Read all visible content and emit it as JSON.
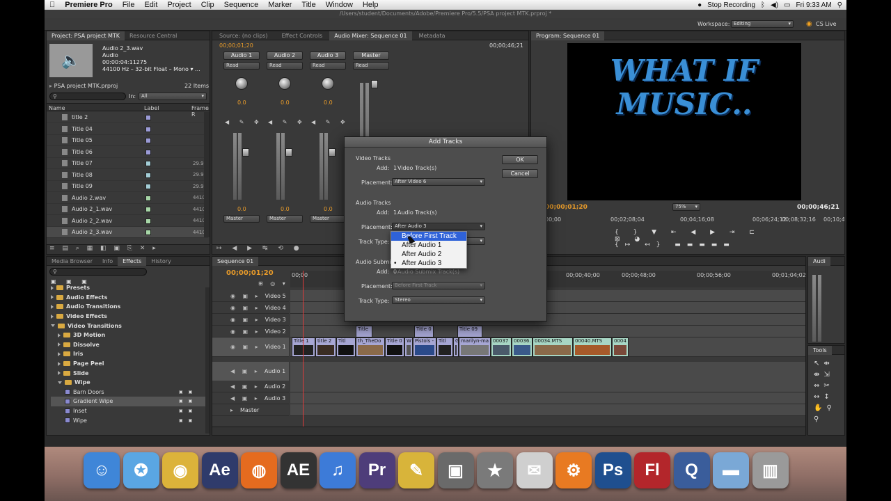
{
  "menubar": {
    "apple": "",
    "app": "Premiere Pro",
    "items": [
      "File",
      "Edit",
      "Project",
      "Clip",
      "Sequence",
      "Marker",
      "Title",
      "Window",
      "Help"
    ],
    "stop_recording": "Stop Recording",
    "clock": "Fri 9:33 AM"
  },
  "window_title": "/Users/student/Documents/Adobe/Premiere Pro/5.5/PSA project MTK.prproj *",
  "workspace": {
    "label": "Workspace:",
    "value": "Editing",
    "cs_live": "CS Live"
  },
  "project_panel": {
    "tabs": [
      "Project: PSA project MTK",
      "Resource Central"
    ],
    "clip_name": "Audio 2_3.wav",
    "clip_type": "Audio",
    "clip_duration": "00:00:04:11275",
    "clip_format": "44100 Hz – 32-bit Float – Mono",
    "clip_format_more": "▾ ...",
    "project_file": "PSA project MTK.prproj",
    "item_count": "22 Items",
    "in_label": "In:",
    "in_value": "All",
    "columns": [
      "Name",
      "Label",
      "Frame R"
    ],
    "items": [
      {
        "name": "title 2",
        "label_color": "#9b9bd6",
        "frame": ""
      },
      {
        "name": "Title 04",
        "label_color": "#9b9bd6",
        "frame": ""
      },
      {
        "name": "Title 05",
        "label_color": "#9b9bd6",
        "frame": ""
      },
      {
        "name": "Title 06",
        "label_color": "#9b9bd6",
        "frame": ""
      },
      {
        "name": "Title 07",
        "label_color": "#a3cdd6",
        "frame": "29.9"
      },
      {
        "name": "Title 08",
        "label_color": "#a3cdd6",
        "frame": "29.9"
      },
      {
        "name": "Title 09",
        "label_color": "#a3cdd6",
        "frame": "29.9"
      },
      {
        "name": "Audio 2.wav",
        "label_color": "#a7d6a7",
        "frame": "4410"
      },
      {
        "name": "Audio 2_1.wav",
        "label_color": "#a7d6a7",
        "frame": "4410"
      },
      {
        "name": "Audio 2_2.wav",
        "label_color": "#a7d6a7",
        "frame": "4410"
      },
      {
        "name": "Audio 2_3.wav",
        "label_color": "#a7d6a7",
        "frame": "4410"
      }
    ]
  },
  "source_panel": {
    "tabs": [
      "Source: (no clips)",
      "Effect Controls",
      "Audio Mixer: Sequence 01",
      "Metadata"
    ],
    "timecode_left": "00;00;01;20",
    "timecode_right": "00;00;46;21",
    "channels": [
      {
        "name": "Audio 1",
        "mode": "Read",
        "value": "0.0",
        "out": "Master",
        "level": "0.0"
      },
      {
        "name": "Audio 2",
        "mode": "Read",
        "value": "0.0",
        "out": "Master",
        "level": "0.0"
      },
      {
        "name": "Audio 3",
        "mode": "Read",
        "value": "0.0",
        "out": "Master",
        "level": "0.0"
      },
      {
        "name": "Master",
        "mode": "Read",
        "value": "",
        "out": "",
        "level": ""
      }
    ]
  },
  "program_panel": {
    "tab": "Program: Sequence 01",
    "title_line1": "WHAT IF",
    "title_line2": "MUSIC..",
    "timecode": "00;00;01;20",
    "zoom": "75%",
    "duration": "00;00;46;21",
    "ruler": [
      "00;00",
      "00;02;08;04",
      "00;04;16;08",
      "00;06;24;12",
      "00;08;32;16",
      "00;10;4"
    ]
  },
  "effects_panel": {
    "tabs": [
      "Media Browser",
      "Info",
      "Effects",
      "History"
    ],
    "items": [
      {
        "label": "Presets",
        "kind": "folder",
        "indent": 0,
        "open": false
      },
      {
        "label": "Audio Effects",
        "kind": "folder",
        "indent": 0,
        "open": false
      },
      {
        "label": "Audio Transitions",
        "kind": "folder",
        "indent": 0,
        "open": false
      },
      {
        "label": "Video Effects",
        "kind": "folder",
        "indent": 0,
        "open": false
      },
      {
        "label": "Video Transitions",
        "kind": "folder",
        "indent": 0,
        "open": true
      },
      {
        "label": "3D Motion",
        "kind": "folder",
        "indent": 1,
        "open": false
      },
      {
        "label": "Dissolve",
        "kind": "folder",
        "indent": 1,
        "open": false
      },
      {
        "label": "Iris",
        "kind": "folder",
        "indent": 1,
        "open": false
      },
      {
        "label": "Page Peel",
        "kind": "folder",
        "indent": 1,
        "open": false
      },
      {
        "label": "Slide",
        "kind": "folder",
        "indent": 1,
        "open": false
      },
      {
        "label": "Wipe",
        "kind": "folder",
        "indent": 1,
        "open": true
      },
      {
        "label": "Barn Doors",
        "kind": "effect",
        "indent": 2,
        "open": false
      },
      {
        "label": "Gradient Wipe",
        "kind": "effect",
        "indent": 2,
        "open": false
      },
      {
        "label": "Inset",
        "kind": "effect",
        "indent": 2,
        "open": false
      },
      {
        "label": "Wipe",
        "kind": "effect",
        "indent": 2,
        "open": false
      }
    ]
  },
  "timeline": {
    "tab": "Sequence 01",
    "timecode": "00;00;01;20",
    "ruler": [
      "00;00",
      "00;00",
      "00;00;40;00",
      "00;00;48;00",
      "00;00;56;00",
      "00;01;04;02",
      "00;01"
    ],
    "tracks": [
      "Video 5",
      "Video 4",
      "Video 3",
      "Video 2",
      "Video 1",
      "Audio 1",
      "Audio 2",
      "Audio 3",
      "Master"
    ],
    "v2_clips": [
      "Title",
      "Title 0",
      "Title 09"
    ],
    "v1_clips": [
      "Title 1",
      "title 2",
      "Titl",
      "th_TheDo",
      "Title 0",
      "W",
      "Pistols -",
      "Titl",
      "G",
      "marilyn-ma",
      "00037",
      "00036.",
      "00034.MTS",
      "00040.MTS",
      "0004"
    ]
  },
  "audio_panel": {
    "tab": "Audi",
    "tools_tab": "Tools"
  },
  "dialog": {
    "title": "Add Tracks",
    "ok": "OK",
    "cancel": "Cancel",
    "video_section": "Video Tracks",
    "add_label": "Add:",
    "video_count": "1",
    "video_unit": "Video Track(s)",
    "placement_label": "Placement:",
    "video_placement": "After Video 6",
    "audio_section": "Audio Tracks",
    "audio_count": "1",
    "audio_unit": "Audio Track(s)",
    "audio_placement": "After Audio 3",
    "track_type_label": "Track Type:",
    "submix_section": "Audio Submix Tracks",
    "submix_count": "0",
    "submix_unit": "Audio Submix Track(s)",
    "submix_placement": "Before First Track",
    "submix_type": "Stereo",
    "menu_options": [
      "Before First Track",
      "After Audio 1",
      "After Audio 2",
      "After Audio 3"
    ],
    "menu_selected": 0,
    "menu_checked": 3
  },
  "dock": {
    "icons": [
      {
        "name": "finder-icon",
        "glyph": "☺",
        "color": "#3f86d8"
      },
      {
        "name": "safari-icon",
        "glyph": "✪",
        "color": "#5aa6e3"
      },
      {
        "name": "chrome-icon",
        "glyph": "◉",
        "color": "#dcb33a"
      },
      {
        "name": "after-effects-icon",
        "glyph": "Ae",
        "color": "#2f3b6b"
      },
      {
        "name": "firefox-icon",
        "glyph": "◍",
        "color": "#e56b1f"
      },
      {
        "name": "ae-logo-icon",
        "glyph": "AE",
        "color": "#333333"
      },
      {
        "name": "itunes-icon",
        "glyph": "♫",
        "color": "#3d7bd8"
      },
      {
        "name": "premiere-icon",
        "glyph": "Pr",
        "color": "#4e3d7a"
      },
      {
        "name": "doodle-icon",
        "glyph": "✎",
        "color": "#d8b43a"
      },
      {
        "name": "iphoto-icon",
        "glyph": "▣",
        "color": "#6a6a6a"
      },
      {
        "name": "imovie-icon",
        "glyph": "★",
        "color": "#7a7a7a"
      },
      {
        "name": "preview-icon",
        "glyph": "✉",
        "color": "#cfcfcf"
      },
      {
        "name": "system-prefs-icon",
        "glyph": "⚙",
        "color": "#e87a22"
      },
      {
        "name": "photoshop-icon",
        "glyph": "Ps",
        "color": "#1f4f8f"
      },
      {
        "name": "flash-icon",
        "glyph": "Fl",
        "color": "#b3262b"
      },
      {
        "name": "quicktime-icon",
        "glyph": "Q",
        "color": "#3a5d9b"
      },
      {
        "name": "folder-icon",
        "glyph": "▬",
        "color": "#7aa8d6"
      },
      {
        "name": "trash-icon",
        "glyph": "▥",
        "color": "#9a9a9a"
      }
    ]
  }
}
